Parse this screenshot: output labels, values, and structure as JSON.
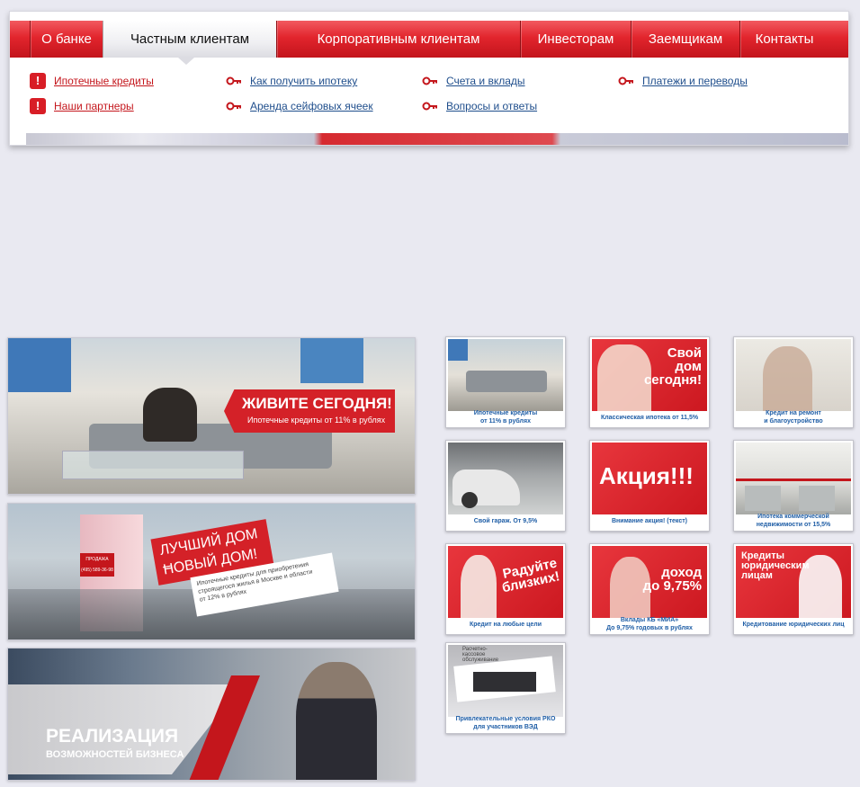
{
  "nav": {
    "items": [
      {
        "label": "О банке"
      },
      {
        "label": "Частным клиентам"
      },
      {
        "label": "Корпоративным клиентам"
      },
      {
        "label": "Инвесторам"
      },
      {
        "label": "Заемщикам"
      },
      {
        "label": "Контакты"
      }
    ],
    "active": "Частным клиентам"
  },
  "submenu": {
    "col1": [
      "Ипотечные кредиты",
      "Наши партнеры"
    ],
    "col2": [
      "Как получить ипотеку",
      "Аренда сейфовых ячеек"
    ],
    "col3": [
      "Счета и вклады",
      "Вопросы и ответы"
    ],
    "col4": [
      "Платежи и переводы"
    ],
    "icons": {
      "col1": "warning-icon",
      "other": "key-icon"
    },
    "colors": {
      "accent": "#d81e26",
      "link": "#1f4e8c",
      "link_active": "#c4161c"
    }
  },
  "banners": {
    "b1": {
      "title": "ЖИВИТЕ СЕГОДНЯ!",
      "subtitle": "Ипотечные кредиты от 11% в рублях"
    },
    "b2": {
      "title1": "ЛУЧШИЙ ДОМ –",
      "title2": "НОВЫЙ ДОМ!",
      "text1": "Ипотечные кредиты для приобретения",
      "text2": "строящегося жилья в Москве и области",
      "text3": "от 12% в рублях",
      "sign": "ПРОДАЖА",
      "phone": "(495) 589-36-98"
    },
    "b3": {
      "title": "РЕАЛИЗАЦИЯ",
      "subtitle": "ВОЗМОЖНОСТЕЙ БИЗНЕСА"
    }
  },
  "thumbs": [
    {
      "caption": "Ипотечные кредиты\nот 11% в рублях",
      "overlay": ""
    },
    {
      "caption": "Классическая ипотека от 11,5%",
      "overlay": "Свой\nдом\nсегодня!"
    },
    {
      "caption": "Кредит на ремонт\nи благоустройство",
      "overlay": ""
    },
    {
      "caption": "Свой гараж. От 9,5%",
      "overlay": ""
    },
    {
      "caption": "Внимание акция! (текст)",
      "overlay": "Акция!!!"
    },
    {
      "caption": "Ипотека коммерческой\nнедвижимости от 15,5%",
      "overlay": ""
    },
    {
      "caption": "Кредит на любые цели",
      "overlay": "Радуйте\nблизких!"
    },
    {
      "caption": "Вклады КБ «МИА»\nДо 9,75% годовых в рублях",
      "overlay": "доход\nдо 9,75%"
    },
    {
      "caption": "Кредитование юридических лиц",
      "overlay": "Кредиты\nюридическим\nлицам"
    },
    {
      "caption": "Привлекательные условия РКО\nдля участников ВЭД",
      "overlay": "Расчетно-\nкассовое\nобслуживание"
    }
  ]
}
